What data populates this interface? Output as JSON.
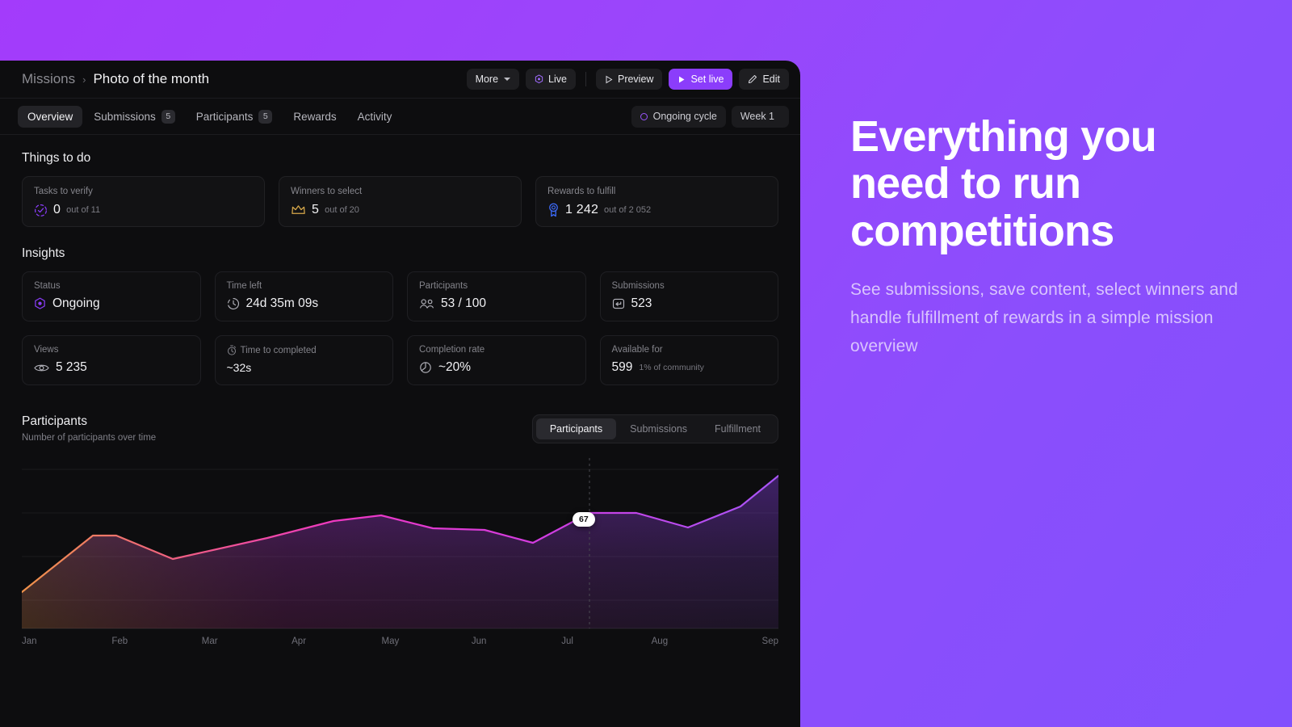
{
  "header": {
    "breadcrumb_root": "Missions",
    "breadcrumb_sep": "›",
    "breadcrumb_current": "Photo of the month",
    "buttons": {
      "more": "More",
      "live": "Live",
      "preview": "Preview",
      "set_live": "Set live",
      "edit": "Edit"
    }
  },
  "tabs": [
    {
      "label": "Overview",
      "badge": ""
    },
    {
      "label": "Submissions",
      "badge": "5"
    },
    {
      "label": "Participants",
      "badge": "5"
    },
    {
      "label": "Rewards",
      "badge": ""
    },
    {
      "label": "Activity",
      "badge": ""
    }
  ],
  "tabs_right": {
    "cycle": "Ongoing cycle",
    "week": "Week 1"
  },
  "things_to_do": {
    "title": "Things to do",
    "cards": [
      {
        "label": "Tasks to verify",
        "value": "0",
        "sub": "out of 11",
        "icon": "check-circle-icon",
        "color": "#8b3dfb"
      },
      {
        "label": "Winners to select",
        "value": "5",
        "sub": "out of 20",
        "icon": "crown-icon",
        "color": "#d8a94a"
      },
      {
        "label": "Rewards to fulfill",
        "value": "1 242",
        "sub": "out of 2 052",
        "icon": "medal-icon",
        "color": "#3d6bfb"
      }
    ]
  },
  "insights": {
    "title": "Insights",
    "cards": [
      {
        "label": "Status",
        "value": "Ongoing",
        "icon": "hexagon-status-icon",
        "note": ""
      },
      {
        "label": "Time left",
        "value": "24d 35m 09s",
        "icon": "clock-icon",
        "note": ""
      },
      {
        "label": "Participants",
        "value": "53 / 100",
        "icon": "people-icon",
        "note": ""
      },
      {
        "label": "Submissions",
        "value": "523",
        "icon": "submission-icon",
        "note": ""
      },
      {
        "label": "Views",
        "value": "5 235",
        "icon": "eye-icon",
        "note": ""
      },
      {
        "label": "Time to completed",
        "value": "~32s",
        "icon": "stopwatch-icon",
        "label_icon": true,
        "note": ""
      },
      {
        "label": "Completion rate",
        "value": "~20%",
        "icon": "pie-icon",
        "note": ""
      },
      {
        "label": "Available for",
        "value": "599",
        "icon": "",
        "note": "1% of community"
      }
    ]
  },
  "chart_panel": {
    "title": "Participants",
    "subtitle": "Number of participants over time",
    "segments": [
      "Participants",
      "Submissions",
      "Fulfillment"
    ],
    "active_segment": "Participants"
  },
  "chart_data": {
    "type": "area",
    "title": "Participants",
    "subtitle": "Number of participants over time",
    "xlabel": "",
    "ylabel": "Number of participants",
    "grid": true,
    "legend": false,
    "categories": [
      "Jan",
      "Feb",
      "Mar",
      "Apr",
      "May",
      "Jun",
      "Jul",
      "Aug",
      "Sep"
    ],
    "x": [
      0,
      1,
      2,
      3,
      4,
      5,
      6,
      7,
      8
    ],
    "values": [
      22,
      45,
      33,
      52,
      57,
      41,
      67,
      60,
      92
    ],
    "points": [
      {
        "x": 0.0,
        "value": 22
      },
      {
        "x": 0.75,
        "value": 45
      },
      {
        "x": 1.0,
        "value": 45
      },
      {
        "x": 1.6,
        "value": 33
      },
      {
        "x": 2.6,
        "value": 44
      },
      {
        "x": 3.3,
        "value": 52
      },
      {
        "x": 3.8,
        "value": 55
      },
      {
        "x": 4.35,
        "value": 49
      },
      {
        "x": 4.9,
        "value": 48
      },
      {
        "x": 5.4,
        "value": 41
      },
      {
        "x": 6.0,
        "value": 67
      },
      {
        "x": 6.5,
        "value": 67
      },
      {
        "x": 7.05,
        "value": 60
      },
      {
        "x": 7.6,
        "value": 69
      },
      {
        "x": 8.0,
        "value": 92
      }
    ],
    "ylim": [
      0,
      100
    ],
    "highlight": {
      "label": "67",
      "x_index": 6,
      "value": 67
    },
    "line_gradient": [
      "#f0934a",
      "#ee38c2",
      "#a855f7"
    ],
    "area_gradient_top": "#8b3dfb"
  },
  "marketing": {
    "heading": "Everything you need to run competitions",
    "body": "See submissions, save content, select winners and handle fulfillment of rewards in a simple mission overview"
  },
  "colors": {
    "accent": "#8b3dfb",
    "panel_bg": "#0d0d0f",
    "card_bg": "#121214",
    "bg_gradient_from": "#a33bfb",
    "bg_gradient_to": "#8250fd"
  }
}
